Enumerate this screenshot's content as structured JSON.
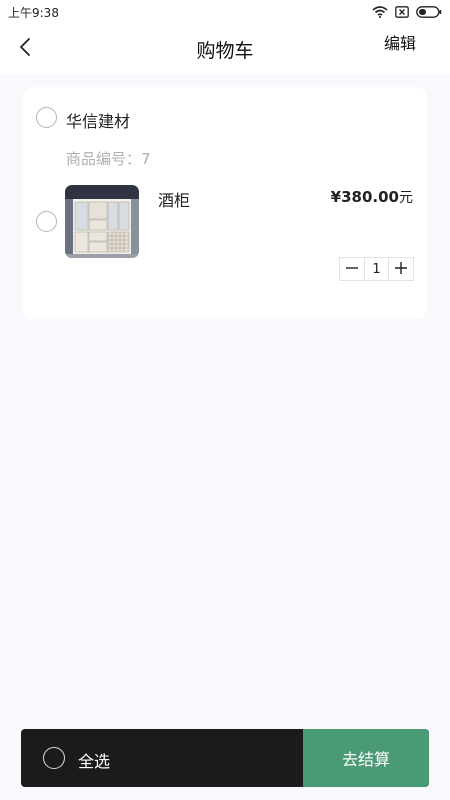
{
  "status_bar": {
    "time": "上午9:38",
    "icons": [
      "wifi-icon",
      "sim-off-icon",
      "battery-icon"
    ]
  },
  "nav": {
    "title": "购物车",
    "edit_label": "编辑",
    "back_icon": "chevron-left-icon"
  },
  "cart": {
    "shop": {
      "name": "华信建材",
      "selected": false
    },
    "items": [
      {
        "code_label": "商品编号：7",
        "name": "酒柜",
        "price": "¥380.00",
        "price_unit": "元",
        "quantity": "1",
        "image": "wine-cabinet-photo",
        "selected": false
      }
    ]
  },
  "bottom_bar": {
    "select_all_label": "全选",
    "checkout_label": "去结算"
  },
  "colors": {
    "accent": "#4b9a76",
    "bottom_bar": "#1b1b1b",
    "page_background": "#f8f8fd"
  }
}
